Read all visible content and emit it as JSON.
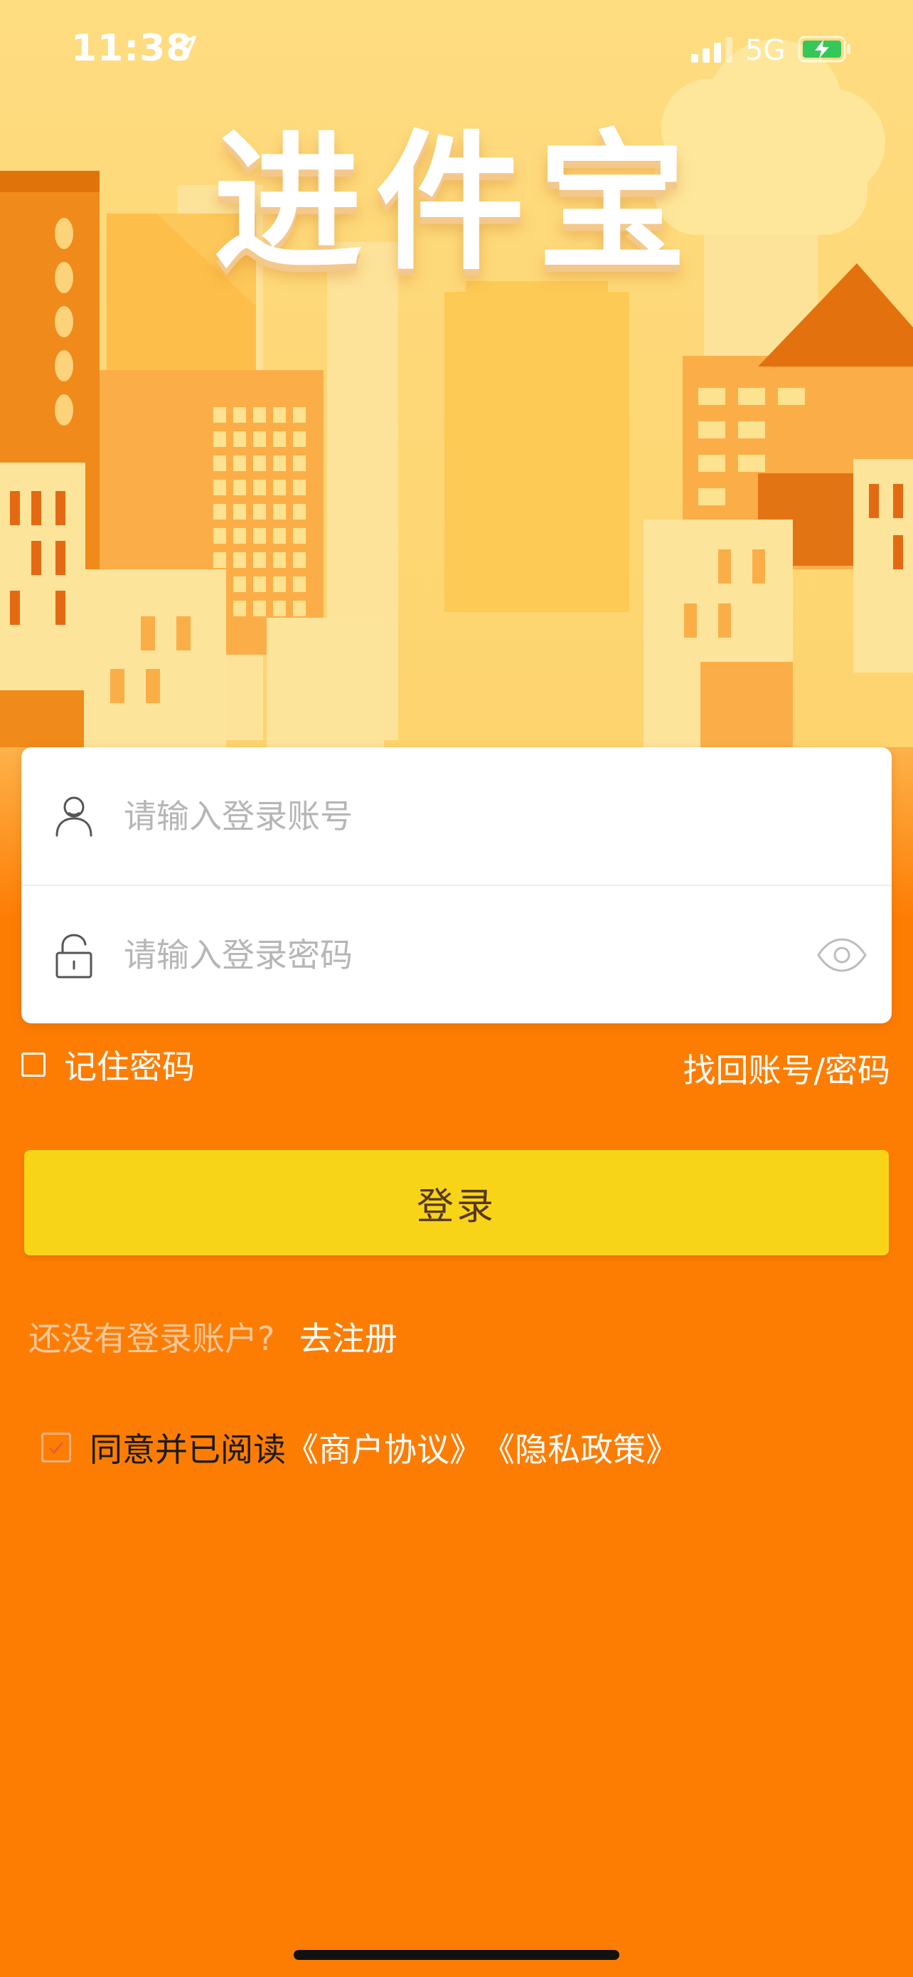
{
  "status_bar": {
    "time": "11:38",
    "network": "5G",
    "icons": [
      "location-arrow-icon",
      "signal-bars-icon",
      "battery-charging-icon"
    ]
  },
  "app": {
    "title": "进件宝"
  },
  "login_form": {
    "account_placeholder": "请输入登录账号",
    "password_placeholder": "请输入登录密码",
    "icons": [
      "user-icon",
      "lock-icon",
      "eye-icon"
    ]
  },
  "options": {
    "remember_label": "记住密码",
    "forgot_link": "找回账号/密码"
  },
  "login_button": {
    "label": "登录"
  },
  "register": {
    "hint": "还没有登录账户?",
    "link": "去注册"
  },
  "agreement": {
    "text": "同意并已阅读",
    "merchant_link": "《商户协议》",
    "privacy_link": "《隐私政策》"
  },
  "colors": {
    "background": "#fd7d03",
    "button": "#f8d419",
    "hero_sky": "#fdd77a"
  }
}
